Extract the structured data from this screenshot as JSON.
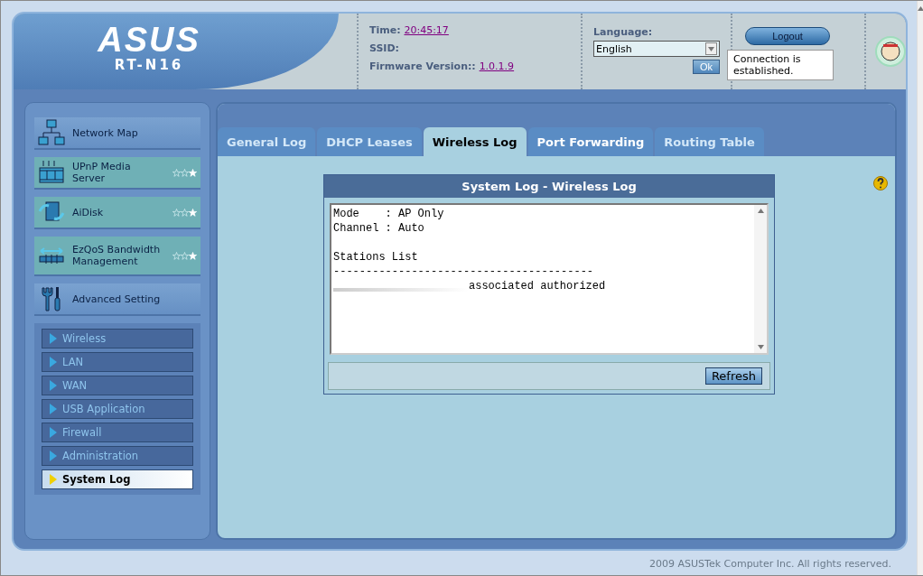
{
  "header": {
    "logo": "ASUS",
    "model": "RT-N16",
    "time_label": "Time:",
    "time": "20:45:17",
    "ssid_label": "SSID:",
    "firmware_label": "Firmware Version::",
    "firmware": "1.0.1.9",
    "language_label": "Language:",
    "language": "English",
    "ok": "Ok",
    "logout": "Logout",
    "status_tooltip": "Connection is established."
  },
  "sidebar": {
    "items": [
      {
        "label": "Network Map",
        "kind": "plain"
      },
      {
        "label": "UPnP Media Server",
        "kind": "feature",
        "stars": 1
      },
      {
        "label": "AiDisk",
        "kind": "feature",
        "stars": 1
      },
      {
        "label": "EzQoS Bandwidth Management",
        "kind": "feature",
        "stars": 1
      },
      {
        "label": "Advanced Setting",
        "kind": "plain"
      }
    ],
    "submenu": [
      {
        "label": "Wireless",
        "selected": false
      },
      {
        "label": "LAN",
        "selected": false
      },
      {
        "label": "WAN",
        "selected": false
      },
      {
        "label": "USB Application",
        "selected": false
      },
      {
        "label": "Firewall",
        "selected": false
      },
      {
        "label": "Administration",
        "selected": false
      },
      {
        "label": "System Log",
        "selected": true
      }
    ]
  },
  "tabs": [
    {
      "label": "General Log",
      "selected": false,
      "hovered": false
    },
    {
      "label": "DHCP Leases",
      "selected": false,
      "hovered": false
    },
    {
      "label": "Wireless Log",
      "selected": true,
      "hovered": false
    },
    {
      "label": "Port Forwarding",
      "selected": false,
      "hovered": true
    },
    {
      "label": "Routing Table",
      "selected": false,
      "hovered": false
    }
  ],
  "log_panel": {
    "title": "System Log - Wireless Log",
    "lines": [
      {
        "kind": "text",
        "text": "Mode    : AP Only"
      },
      {
        "kind": "text",
        "text": "Channel : Auto"
      },
      {
        "kind": "blank"
      },
      {
        "kind": "text",
        "text": "Stations List"
      },
      {
        "kind": "text",
        "text": "----------------------------------------"
      },
      {
        "kind": "station",
        "text": "associated authorized"
      }
    ],
    "refresh": "Refresh"
  },
  "footer": "2009 ASUSTek Computer Inc. All rights reserved."
}
